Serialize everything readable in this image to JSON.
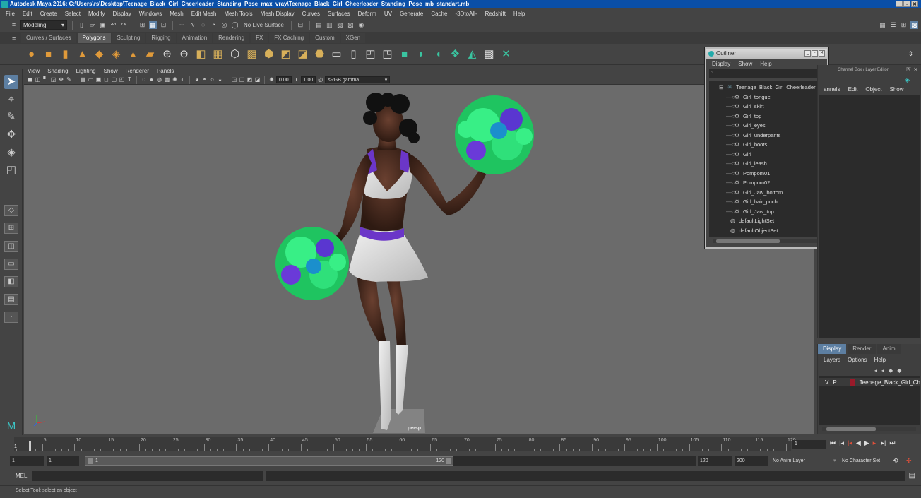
{
  "window": {
    "title": "Autodesk Maya 2016: C:\\Users\\rs\\Desktop\\Teenage_Black_Girl_Cheerleader_Standing_Pose_max_vray\\Teenage_Black_Girl_Cheerleader_Standing_Pose_mb_standart.mb",
    "controls": [
      "_",
      "▫",
      "✕"
    ]
  },
  "menubar": [
    "File",
    "Edit",
    "Create",
    "Select",
    "Modify",
    "Display",
    "Windows",
    "Mesh",
    "Edit Mesh",
    "Mesh Tools",
    "Mesh Display",
    "Curves",
    "Surfaces",
    "Deform",
    "UV",
    "Generate",
    "Cache",
    "-3DtoAll-",
    "Redshift",
    "Help"
  ],
  "statusline": {
    "mode": "Modeling",
    "live_surface": "No Live Surface"
  },
  "shelf_tabs": [
    "Curves / Surfaces",
    "Polygons",
    "Sculpting",
    "Rigging",
    "Animation",
    "Rendering",
    "FX",
    "FX Caching",
    "Custom",
    "XGen"
  ],
  "shelf_active_tab": "Polygons",
  "viewport": {
    "menu": [
      "View",
      "Shading",
      "Lighting",
      "Show",
      "Renderer",
      "Panels"
    ],
    "exposure": "0.00",
    "gamma": "1.00",
    "color_space": "sRGB gamma",
    "camera_label": "persp"
  },
  "outliner": {
    "title": "Outliner",
    "menu": [
      "Display",
      "Show",
      "Help"
    ],
    "root": "Teenage_Black_Girl_Cheerleader_",
    "children": [
      "Girl_tongue",
      "Girl_skirt",
      "Girl_top",
      "Girl_eyes",
      "Girl_underpants",
      "Girl_boots",
      "Girl",
      "Girl_leash",
      "Pompom01",
      "Pompom02",
      "Girl_Jaw_bottom",
      "Girl_hair_puch",
      "Girl_Jaw_top"
    ],
    "sets": [
      "defaultLightSet",
      "defaultObjectSet"
    ]
  },
  "channel_box": {
    "title": "Channel Box / Layer Editor",
    "menu": [
      "annels",
      "Edit",
      "Object",
      "Show"
    ]
  },
  "layer_editor": {
    "tabs": [
      "Display",
      "Render",
      "Anim"
    ],
    "active_tab": "Display",
    "menu": [
      "Layers",
      "Options",
      "Help"
    ],
    "layer": {
      "v": "V",
      "p": "P",
      "name": "Teenage_Black_Girl_Ch",
      "color": "#9a1a2a"
    }
  },
  "timeline": {
    "ticks": [
      "5",
      "10",
      "15",
      "20",
      "25",
      "30",
      "35",
      "40",
      "45",
      "50",
      "55",
      "60",
      "65",
      "70",
      "75",
      "80",
      "85",
      "90",
      "95",
      "100",
      "105",
      "110",
      "115",
      "120"
    ],
    "current_frame_label": "1",
    "current_frame_field": "1"
  },
  "range": {
    "start": "1",
    "start2": "1",
    "inner_start": "1",
    "inner_end": "120",
    "end": "120",
    "end2": "200",
    "anim_layer": "No Anim Layer",
    "char_set": "No Character Set"
  },
  "cmdline": {
    "label": "MEL"
  },
  "helpline": "Select Tool: select an object",
  "colors": {
    "accent": "#5d7fa2",
    "titlebar": "#0a4fa8",
    "pompom_green": "#2fe07a",
    "pompom_purple": "#6a3ad8"
  }
}
